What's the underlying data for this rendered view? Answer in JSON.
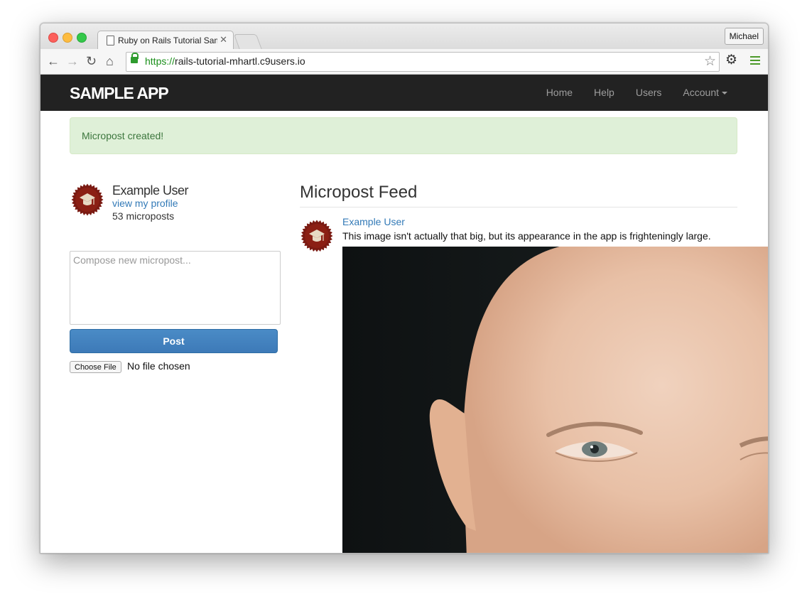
{
  "browser": {
    "tab_title": "Ruby on Rails Tutorial Samp",
    "profile_name": "Michael",
    "url_scheme": "https://",
    "url_host": "rails-tutorial-mhartl.c9users.io"
  },
  "navbar": {
    "logo": "SAMPLE APP",
    "links": [
      "Home",
      "Help",
      "Users",
      "Account"
    ]
  },
  "flash": {
    "message": "Micropost created!"
  },
  "user_info": {
    "name": "Example User",
    "profile_link": "view my profile",
    "micropost_count": "53 microposts"
  },
  "micropost_form": {
    "placeholder": "Compose new micropost...",
    "post_label": "Post",
    "choose_file_label": "Choose File",
    "no_file_label": "No file chosen"
  },
  "feed": {
    "title": "Micropost Feed",
    "items": [
      {
        "user": "Example User",
        "content": "This image isn't actually that big, but its appearance in the app is frighteningly large."
      }
    ]
  },
  "colors": {
    "navbar_bg": "#222222",
    "link": "#337ab7",
    "flash_bg": "#dff0d8",
    "post_button": "#337ab7"
  },
  "icons": [
    "back-icon",
    "forward-icon",
    "reload-icon",
    "home-icon",
    "lock-icon",
    "bookmark-star-icon",
    "settings-gear-icon",
    "menu-icon",
    "gravatar-icon"
  ]
}
